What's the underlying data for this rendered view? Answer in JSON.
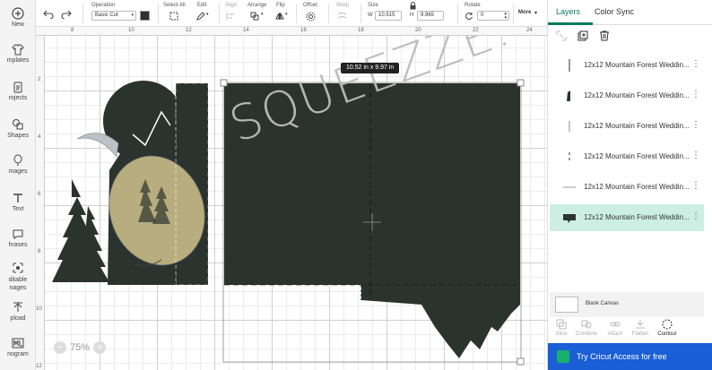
{
  "left_nav": {
    "items": [
      {
        "label": "New",
        "icon": "plus-circle-icon"
      },
      {
        "label": "mplates",
        "icon": "shirt-icon"
      },
      {
        "label": "rojects",
        "icon": "clipboard-icon"
      },
      {
        "label": "Shapes",
        "icon": "shapes-icon"
      },
      {
        "label": "mages",
        "icon": "balloon-icon"
      },
      {
        "label": "Text",
        "icon": "text-t-icon"
      },
      {
        "label": "hrases",
        "icon": "speech-bubble-icon"
      },
      {
        "label": "ditable\nnages",
        "icon": "editable-image-icon"
      },
      {
        "label": "pload",
        "icon": "upload-icon"
      },
      {
        "label": "nogram",
        "icon": "monogram-icon"
      }
    ]
  },
  "toolbar": {
    "operation_label": "Operation",
    "operation_value": "Basic Cut",
    "select_all_label": "Select All",
    "edit_label": "Edit",
    "align_label": "Align",
    "arrange_label": "Arrange",
    "flip_label": "Flip",
    "offset_label": "Offset",
    "warp_label": "Warp",
    "size_label": "Size",
    "w_label": "W",
    "w_value": "10.515",
    "h_label": "H",
    "h_value": "9.965",
    "rotate_label": "Rotate",
    "rotate_value": "0",
    "more_label": "More"
  },
  "rulers": {
    "top": [
      "8",
      "10",
      "12",
      "14",
      "16",
      "18",
      "20",
      "22",
      "24"
    ],
    "left": [
      "2",
      "4",
      "6",
      "8",
      "10",
      "12"
    ]
  },
  "canvas": {
    "dimension_tag": "10.52  in x 9.97  in",
    "zoom_minus": "−",
    "zoom_value": "75%",
    "zoom_plus": "+",
    "design_text": "SQUEEZZE."
  },
  "right_panel": {
    "tabs": [
      {
        "label": "Layers"
      },
      {
        "label": "Color Sync"
      }
    ],
    "layers": [
      {
        "name": "12x12 Mountain Forest Weddin..."
      },
      {
        "name": "12x12 Mountain Forest Weddin..."
      },
      {
        "name": "12x12 Mountain Forest Weddin..."
      },
      {
        "name": "12x12 Mountain Forest Weddin..."
      },
      {
        "name": "12x12 Mountain Forest Weddin..."
      },
      {
        "name": "12x12 Mountain Forest Weddin..."
      }
    ],
    "blank_canvas_label": "Blank Canvas",
    "bottom_tools": [
      {
        "label": "Slice"
      },
      {
        "label": "Combine"
      },
      {
        "label": "Attach"
      },
      {
        "label": "Flatten"
      },
      {
        "label": "Contour"
      }
    ],
    "cta_label": "Try Cricut Access for free"
  },
  "colors": {
    "accent": "#0b7a60",
    "selected_layer": "#cdeee3",
    "cta": "#1b5fd6",
    "design_dark": "#2b332e",
    "lemon_yellow": "#e8d79a"
  }
}
